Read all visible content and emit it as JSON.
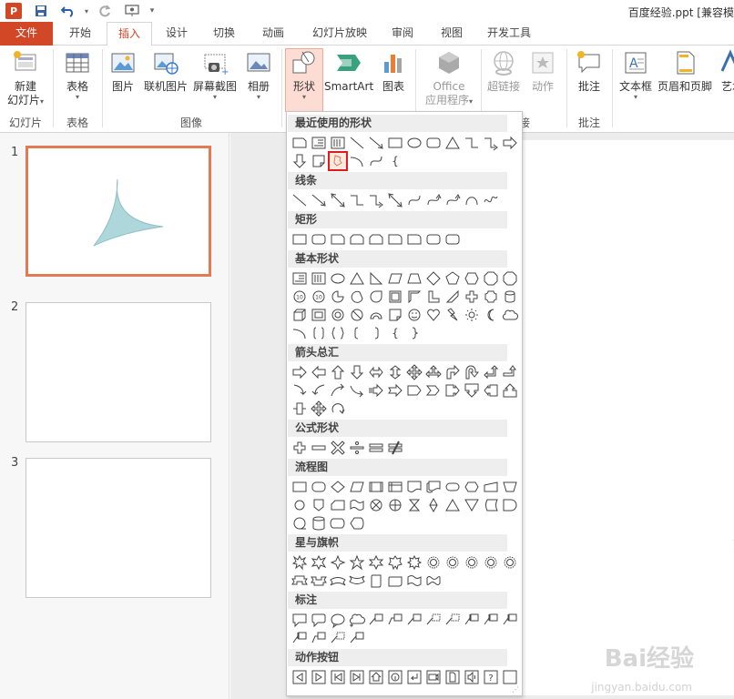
{
  "titlebar": {
    "app_logo": "P",
    "doc_title": "百度经验.ppt [兼容模"
  },
  "tabs": [
    "文件",
    "开始",
    "插入",
    "设计",
    "切换",
    "动画",
    "幻灯片放映",
    "审阅",
    "视图",
    "开发工具"
  ],
  "ribbon": {
    "new_slide": [
      "新建",
      "幻灯片"
    ],
    "table": "表格",
    "picture": "图片",
    "online_picture": "联机图片",
    "screenshot": "屏幕截图",
    "album": "相册",
    "shapes": "形状",
    "smartart": "SmartArt",
    "chart": "图表",
    "office_apps": [
      "Office",
      "应用程序"
    ],
    "hyperlink": "超链接",
    "action": "动作",
    "comment": "批注",
    "textbox": "文本框",
    "header_footer": "页眉和页脚",
    "wordart": "艺术",
    "groups": {
      "slides": "幻灯片",
      "tables": "表格",
      "images": "图像",
      "links": "接",
      "comments": "批注"
    }
  },
  "thumbnails": [
    "1",
    "2",
    "3"
  ],
  "dropdown": {
    "sections": [
      "最近使用的形状",
      "线条",
      "矩形",
      "基本形状",
      "箭头总汇",
      "公式形状",
      "流程图",
      "星与旗帜",
      "标注",
      "动作按钮"
    ],
    "highlighted_shape": "recent-shape-highlighted"
  },
  "watermark": {
    "line1": "Bai经验",
    "line2": "jingyan.baidu.com"
  },
  "colors": {
    "accent": "#d24726",
    "triangle_fill": "#aed7dc",
    "selection": "#e07b53"
  }
}
